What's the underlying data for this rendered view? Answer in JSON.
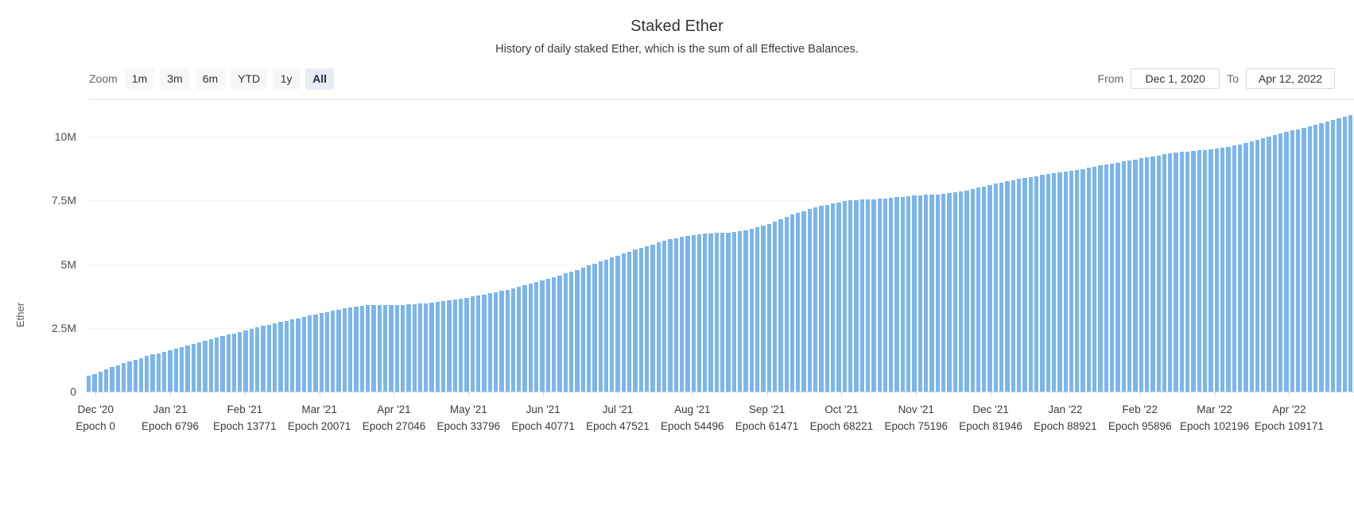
{
  "header": {
    "title": "Staked Ether",
    "subtitle": "History of daily staked Ether, which is the sum of all Effective Balances."
  },
  "toolbar": {
    "zoom_label": "Zoom",
    "zoom_buttons": [
      {
        "label": "1m",
        "selected": false
      },
      {
        "label": "3m",
        "selected": false
      },
      {
        "label": "6m",
        "selected": false
      },
      {
        "label": "YTD",
        "selected": false
      },
      {
        "label": "1y",
        "selected": false
      },
      {
        "label": "All",
        "selected": true
      }
    ],
    "from_label": "From",
    "from_value": "Dec 1, 2020",
    "to_label": "To",
    "to_value": "Apr 12, 2022"
  },
  "colors": {
    "bar": "#7cb5ec",
    "selected_button_bg": "#e6ebf5",
    "button_bg": "#f7f7f7",
    "gridline": "#f2f2f2",
    "axis_line": "#ccd6eb"
  },
  "chart_data": {
    "type": "bar",
    "title": "Staked Ether",
    "subtitle": "History of daily staked Ether, which is the sum of all Effective Balances.",
    "xlabel": "",
    "ylabel": "Ether",
    "ylim": [
      0,
      11250000
    ],
    "y_ticks": [
      0,
      2500000,
      5000000,
      7500000,
      10000000
    ],
    "y_tick_labels": [
      "0",
      "2.5M",
      "5M",
      "7.5M",
      "10M"
    ],
    "grid": true,
    "legend": "none",
    "x_axis_labels": [
      {
        "month": "Dec '20",
        "epoch": "Epoch 0"
      },
      {
        "month": "Jan '21",
        "epoch": "Epoch 6796"
      },
      {
        "month": "Feb '21",
        "epoch": "Epoch 13771"
      },
      {
        "month": "Mar '21",
        "epoch": "Epoch 20071"
      },
      {
        "month": "Apr '21",
        "epoch": "Epoch 27046"
      },
      {
        "month": "May '21",
        "epoch": "Epoch 33796"
      },
      {
        "month": "Jun '21",
        "epoch": "Epoch 40771"
      },
      {
        "month": "Jul '21",
        "epoch": "Epoch 47521"
      },
      {
        "month": "Aug '21",
        "epoch": "Epoch 54496"
      },
      {
        "month": "Sep '21",
        "epoch": "Epoch 61471"
      },
      {
        "month": "Oct '21",
        "epoch": "Epoch 68221"
      },
      {
        "month": "Nov '21",
        "epoch": "Epoch 75196"
      },
      {
        "month": "Dec '21",
        "epoch": "Epoch 81946"
      },
      {
        "month": "Jan '22",
        "epoch": "Epoch 88921"
      },
      {
        "month": "Feb '22",
        "epoch": "Epoch 95896"
      },
      {
        "month": "Mar '22",
        "epoch": "Epoch 102196"
      },
      {
        "month": "Apr '22",
        "epoch": "Epoch 109171"
      }
    ],
    "series": [
      {
        "name": "Staked Ether",
        "color": "#7cb5ec",
        "values": [
          620000,
          700000,
          790000,
          880000,
          960000,
          1040000,
          1110000,
          1180000,
          1250000,
          1320000,
          1390000,
          1450000,
          1510000,
          1570000,
          1630000,
          1690000,
          1750000,
          1810000,
          1870000,
          1930000,
          1990000,
          2050000,
          2110000,
          2170000,
          2230000,
          2290000,
          2350000,
          2410000,
          2470000,
          2530000,
          2580000,
          2630000,
          2680000,
          2730000,
          2780000,
          2830000,
          2880000,
          2930000,
          2980000,
          3030000,
          3080000,
          3130000,
          3180000,
          3220000,
          3260000,
          3300000,
          3330000,
          3360000,
          3390000,
          3400000,
          3400000,
          3400000,
          3400000,
          3400000,
          3410000,
          3420000,
          3430000,
          3450000,
          3470000,
          3500000,
          3530000,
          3560000,
          3590000,
          3620000,
          3650000,
          3690000,
          3730000,
          3770000,
          3810000,
          3850000,
          3900000,
          3950000,
          4000000,
          4050000,
          4110000,
          4170000,
          4230000,
          4290000,
          4350000,
          4420000,
          4490000,
          4560000,
          4630000,
          4700000,
          4780000,
          4860000,
          4940000,
          5020000,
          5100000,
          5180000,
          5260000,
          5340000,
          5420000,
          5500000,
          5570000,
          5640000,
          5710000,
          5780000,
          5850000,
          5910000,
          5970000,
          6020000,
          6070000,
          6110000,
          6150000,
          6180000,
          6200000,
          6210000,
          6220000,
          6230000,
          6240000,
          6260000,
          6290000,
          6330000,
          6380000,
          6440000,
          6510000,
          6590000,
          6670000,
          6760000,
          6850000,
          6940000,
          7020000,
          7090000,
          7160000,
          7220000,
          7280000,
          7330000,
          7380000,
          7430000,
          7470000,
          7500000,
          7520000,
          7530000,
          7540000,
          7550000,
          7560000,
          7580000,
          7600000,
          7620000,
          7650000,
          7670000,
          7690000,
          7710000,
          7720000,
          7730000,
          7740000,
          7760000,
          7790000,
          7820000,
          7860000,
          7900000,
          7950000,
          8000000,
          8050000,
          8100000,
          8150000,
          8200000,
          8250000,
          8300000,
          8340000,
          8380000,
          8420000,
          8460000,
          8500000,
          8530000,
          8560000,
          8590000,
          8620000,
          8660000,
          8700000,
          8740000,
          8780000,
          8820000,
          8870000,
          8910000,
          8950000,
          8990000,
          9030000,
          9070000,
          9110000,
          9150000,
          9190000,
          9230000,
          9270000,
          9310000,
          9340000,
          9370000,
          9400000,
          9420000,
          9440000,
          9460000,
          9480000,
          9500000,
          9530000,
          9560000,
          9600000,
          9650000,
          9700000,
          9760000,
          9820000,
          9880000,
          9940000,
          10000000,
          10060000,
          10120000,
          10180000,
          10240000,
          10300000,
          10360000,
          10420000,
          10480000,
          10540000,
          10600000,
          10660000,
          10720000,
          10780000,
          10830000
        ]
      }
    ]
  }
}
